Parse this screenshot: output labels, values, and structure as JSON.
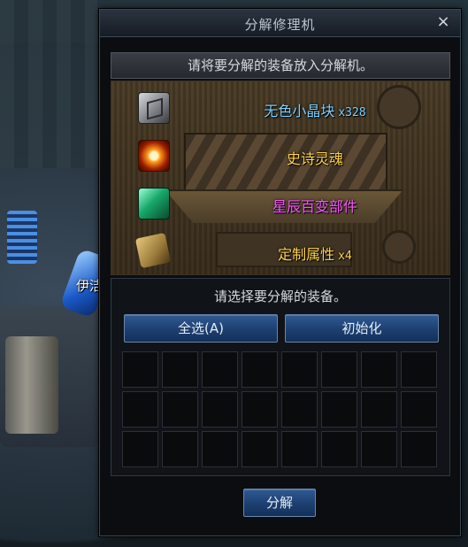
{
  "background": {
    "npc_label": "伊洁"
  },
  "window": {
    "title": "分解修理机",
    "close_icon": "×",
    "instruction": "请将要分解的装备放入分解机。",
    "results": [
      {
        "name": "无色小晶块",
        "count": "x328",
        "color": "#7fd0ff",
        "icon": "crystal-cube-icon"
      },
      {
        "name": "史诗灵魂",
        "count": "",
        "color": "#ffd44a",
        "icon": "epic-soul-icon"
      },
      {
        "name": "星辰百变部件",
        "count": "",
        "color": "#ff55ff",
        "icon": "star-part-icon"
      },
      {
        "name": "定制属性",
        "count": "x4",
        "color": "#ffd44a",
        "icon": "custom-attribute-book-icon"
      }
    ],
    "select_title": "请选择要分解的装备。",
    "select_all_button": "全选(A)",
    "reset_button": "初始化",
    "decompose_button": "分解"
  }
}
